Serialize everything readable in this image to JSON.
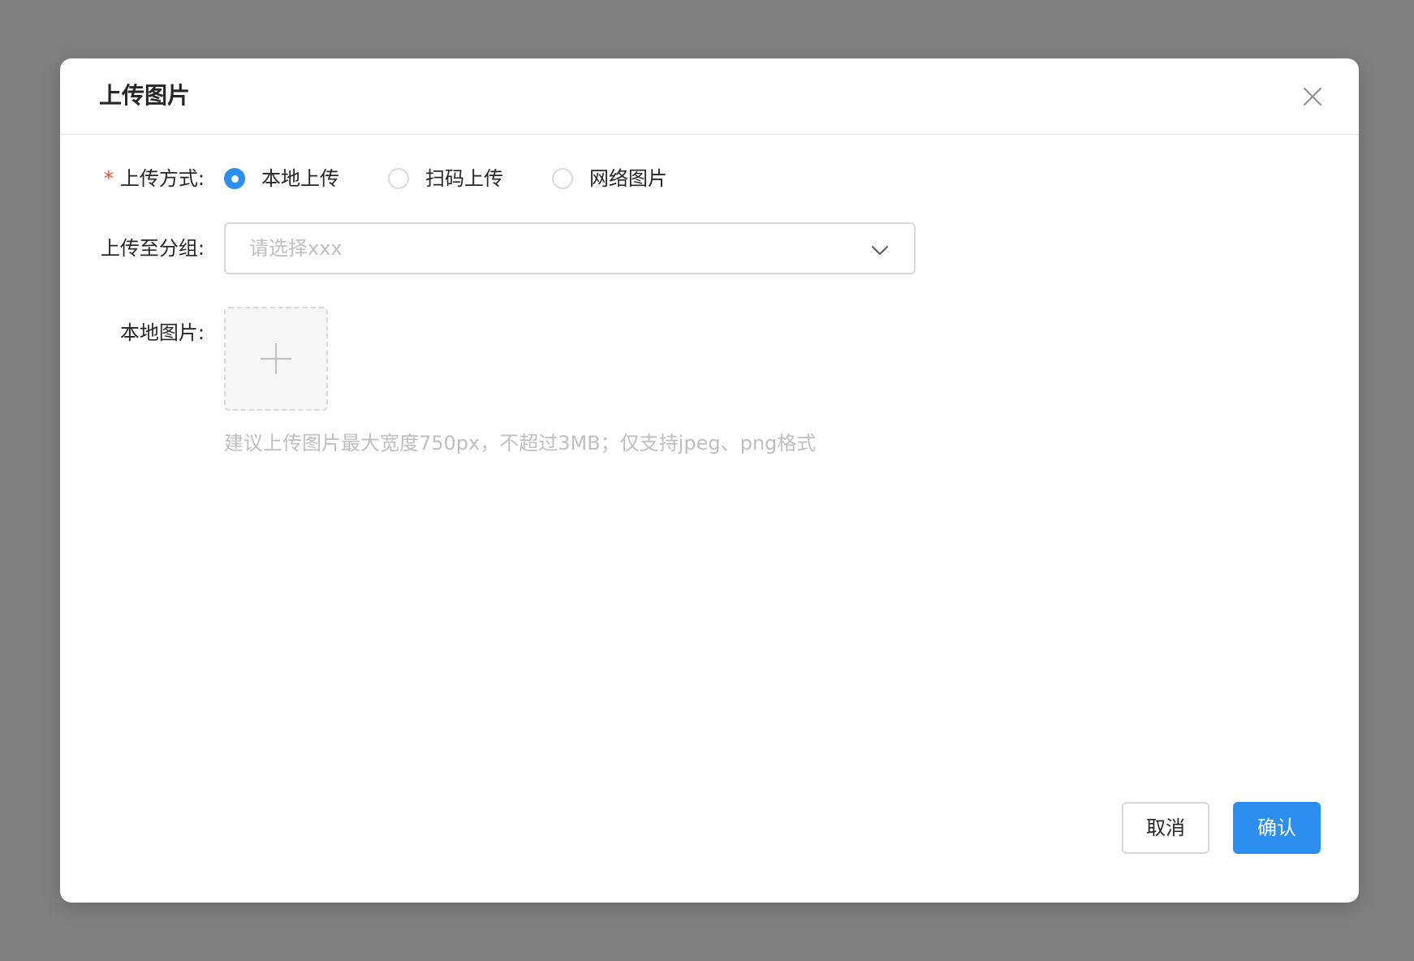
{
  "dialog": {
    "title": "上传图片",
    "close_icon": "close-icon"
  },
  "form": {
    "upload_method": {
      "label": "上传方式:",
      "required": true,
      "options": [
        {
          "label": "本地上传",
          "checked": true
        },
        {
          "label": "扫码上传",
          "checked": false
        },
        {
          "label": "网络图片",
          "checked": false
        }
      ]
    },
    "group": {
      "label": "上传至分组:",
      "placeholder": "请选择xxx",
      "value": "",
      "arrow_icon": "chevron-down-icon"
    },
    "local_image": {
      "label": "本地图片:",
      "add_icon": "plus-icon",
      "hint": "建议上传图片最大宽度750px，不超过3MB；仅支持jpeg、png格式"
    }
  },
  "footer": {
    "cancel_label": "取消",
    "confirm_label": "确认"
  },
  "colors": {
    "overlay": "#808080",
    "primary": "#2b8ef0",
    "required": "#e5502f",
    "placeholder": "#bfbfbf",
    "border": "#d9d9d9"
  }
}
